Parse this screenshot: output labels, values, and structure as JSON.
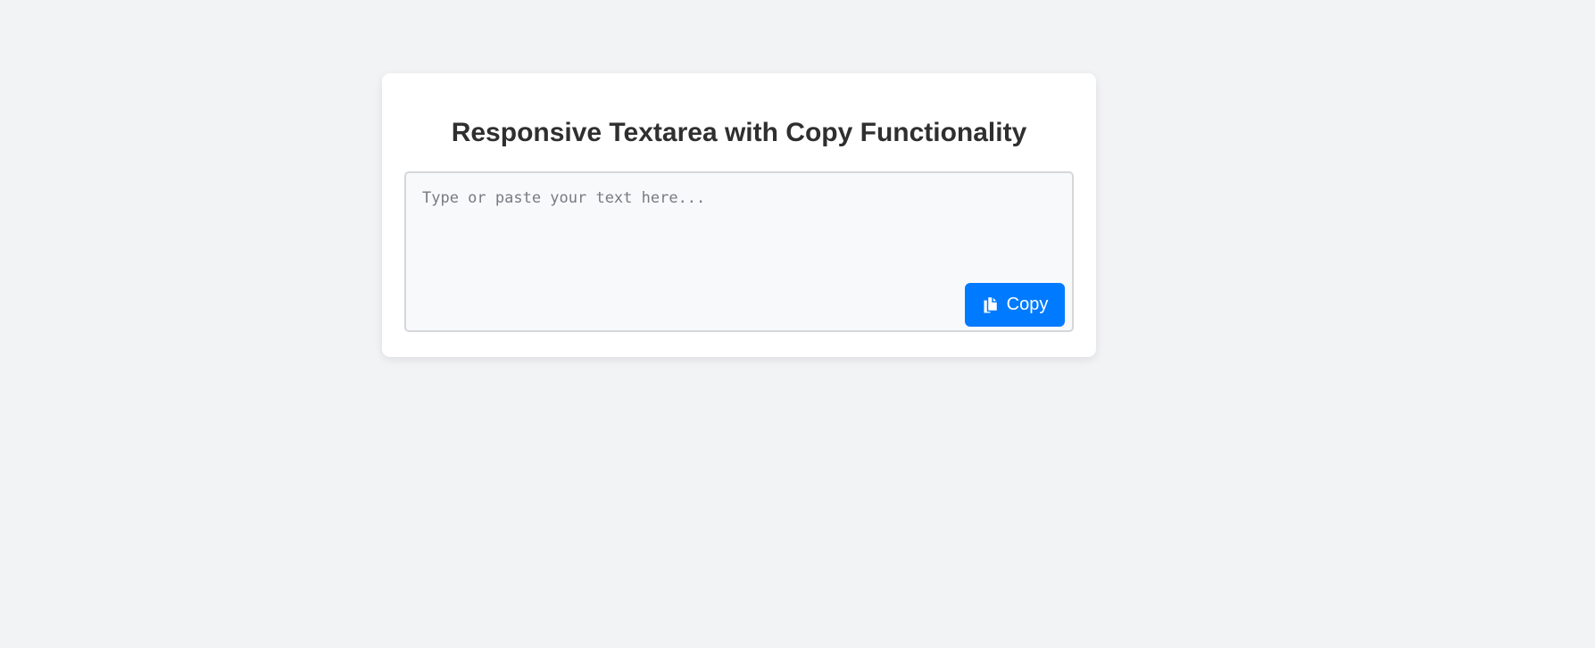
{
  "card": {
    "title": "Responsive Textarea with Copy Functionality"
  },
  "editor": {
    "value": "",
    "placeholder": "Type or paste your text here..."
  },
  "copy_button": {
    "label": "Copy",
    "icon": "copy-icon"
  },
  "colors": {
    "page_background": "#f2f3f5",
    "card_background": "#ffffff",
    "button_background": "#007bff",
    "button_text": "#ffffff",
    "title_text": "#2f2f2f",
    "textarea_background": "#f8f9fb",
    "textarea_border": "#d5d7db"
  }
}
